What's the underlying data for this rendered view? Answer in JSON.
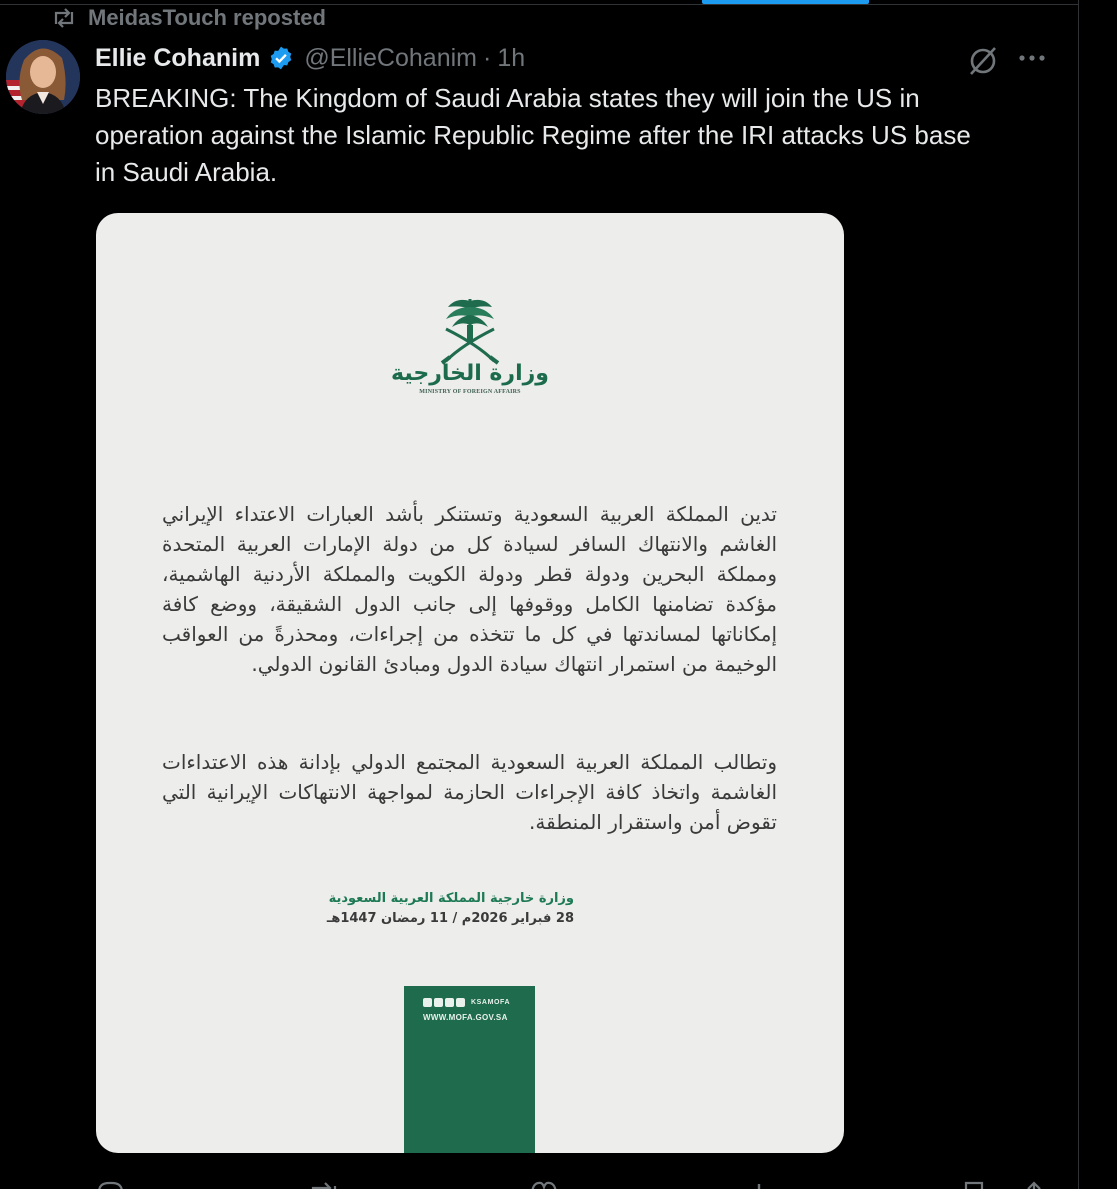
{
  "repost": {
    "label": "MeidasTouch reposted"
  },
  "author": {
    "name": "Ellie Cohanim",
    "handle": "@EllieCohanim",
    "separator": "·",
    "time": "1h"
  },
  "tweet": {
    "text": "BREAKING: The Kingdom of Saudi Arabia states they will join the US in\noperation against the Islamic Republic Regime after the IRI attacks US base\nin Saudi Arabia."
  },
  "media": {
    "ministry_name_ar": "وزارة الخارجية",
    "ministry_name_en": "MINISTRY OF FOREIGN AFFAIRS",
    "paragraph_1": "تدين المملكة العربية السعودية وتستنكر بأشد العبارات الاعتداء الإيراني الغاشم والانتهاك السافر لسيادة كل من دولة الإمارات العربية المتحدة ومملكة البحرين ودولة قطر ودولة الكويت والمملكة الأردنية الهاشمية، مؤكدة تضامنها الكامل ووقوفها إلى جانب الدول الشقيقة، ووضع كافة إمكاناتها لمساندتها في كل ما تتخذه من إجراءات، ومحذرةً من العواقب الوخيمة من استمرار انتهاك سيادة الدول ومبادئ القانون الدولي.",
    "paragraph_2": "وتطالب المملكة العربية السعودية المجتمع الدولي بإدانة هذه الاعتداءات الغاشمة واتخاذ كافة الإجراءات الحازمة لمواجهة الانتهاكات الإيرانية التي تقوض أمن واستقرار المنطقة.",
    "signature": "وزارة خارجية المملكة العربية السعودية",
    "date": "28 فبراير 2026م / 11 رمضان 1447هـ",
    "social_handle": "KSAMOFA",
    "website": "WWW.MOFA.GOV.SA"
  },
  "icons": {
    "repost": "repost-icon",
    "verified": "verified-badge-icon",
    "grok": "grok-icon",
    "more": "more-icon",
    "reply": "reply-icon",
    "retweet": "retweet-icon",
    "like": "like-icon",
    "views": "views-icon",
    "bookmark": "bookmark-icon",
    "share": "share-icon"
  },
  "colors": {
    "background": "#000000",
    "text": "#e7e9ea",
    "muted": "#71767b",
    "accent": "#1d9bf0",
    "mofa_green": "#1f6b4d"
  }
}
